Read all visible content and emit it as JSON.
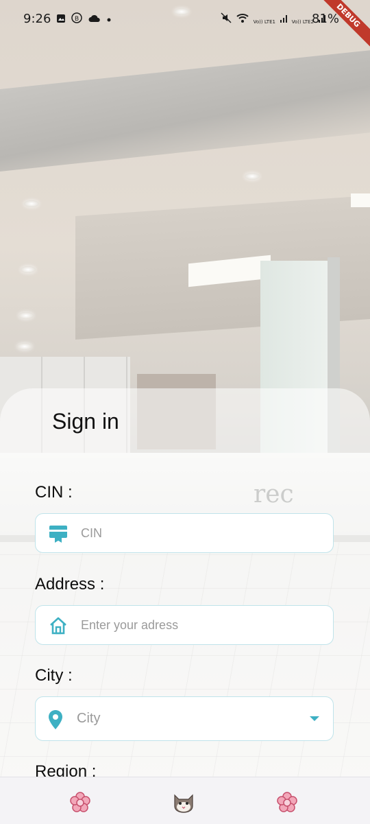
{
  "status_bar": {
    "time": "9:26",
    "battery": "81%",
    "left_icons": [
      "image-icon",
      "b-icon",
      "cloud-icon",
      "dot-icon"
    ],
    "right_icons": [
      "mute-icon",
      "wifi-icon",
      "lte1-signal-icon",
      "lte2-signal-icon"
    ],
    "lte1_text": "Vo)) LTE1",
    "lte2_text": "Vo)) LTE2"
  },
  "debug_banner": "DEBUG",
  "background": {
    "sign_text": "rec"
  },
  "form": {
    "title": "Sign in",
    "cin": {
      "label": "CIN :",
      "placeholder": "CIN",
      "icon": "id-card-icon"
    },
    "address": {
      "label": "Address :",
      "placeholder": "Enter your adress",
      "icon": "home-icon"
    },
    "city": {
      "label": "City :",
      "value": "City",
      "icon": "location-pin-icon"
    },
    "region": {
      "label": "Region :"
    }
  },
  "bottom_nav": {
    "items": [
      {
        "icon": "flower-icon"
      },
      {
        "icon": "cat-face-icon"
      },
      {
        "icon": "flower-icon"
      }
    ]
  },
  "colors": {
    "accent": "#3db0c3",
    "field_border": "#bfe3ea",
    "debug": "#c0392b"
  }
}
